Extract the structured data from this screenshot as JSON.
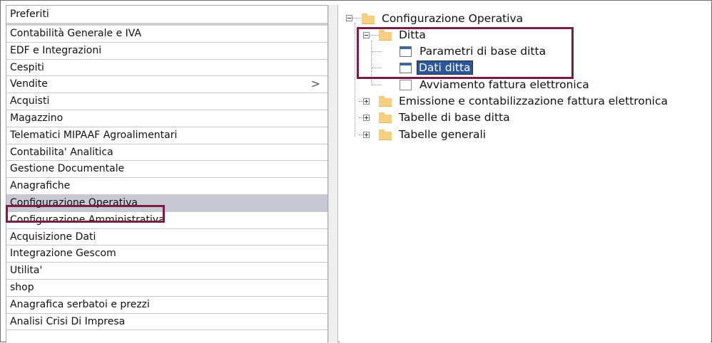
{
  "menu": {
    "header": "Preferiti",
    "items": [
      {
        "label": "Contabilità Generale e IVA"
      },
      {
        "label": "EDF e Integrazioni"
      },
      {
        "label": "Cespiti"
      },
      {
        "label": "Vendite",
        "submenu": ">"
      },
      {
        "label": "Acquisti"
      },
      {
        "label": "Magazzino"
      },
      {
        "label": "Telematici MIPAAF Agroalimentari"
      },
      {
        "label": "Contabilita' Analitica"
      },
      {
        "label": "Gestione Documentale"
      },
      {
        "label": "Anagrafiche"
      },
      {
        "label": "Configurazione Operativa",
        "selected": true
      },
      {
        "label": "Configurazione Amministrativa"
      },
      {
        "label": "Acquisizione Dati"
      },
      {
        "label": "Integrazione Gescom"
      },
      {
        "label": "Utilita'"
      },
      {
        "label": "shop"
      },
      {
        "label": "Anagrafica serbatoi e prezzi"
      },
      {
        "label": "Analisi Crisi Di Impresa"
      }
    ]
  },
  "tree": {
    "root": "Configurazione Operativa",
    "ditta": "Ditta",
    "ditta_children": [
      "Parametri di base ditta",
      "Dati ditta",
      "Avviamento fattura elettronica"
    ],
    "siblings": [
      "Emissione e contabilizzazione fattura elettronica",
      "Tabelle di base ditta",
      "Tabelle generali"
    ]
  },
  "colors": {
    "highlight_border": "#7b1e46",
    "selection": "#2b579a",
    "menu_selected_bg": "#c9c9d3"
  }
}
